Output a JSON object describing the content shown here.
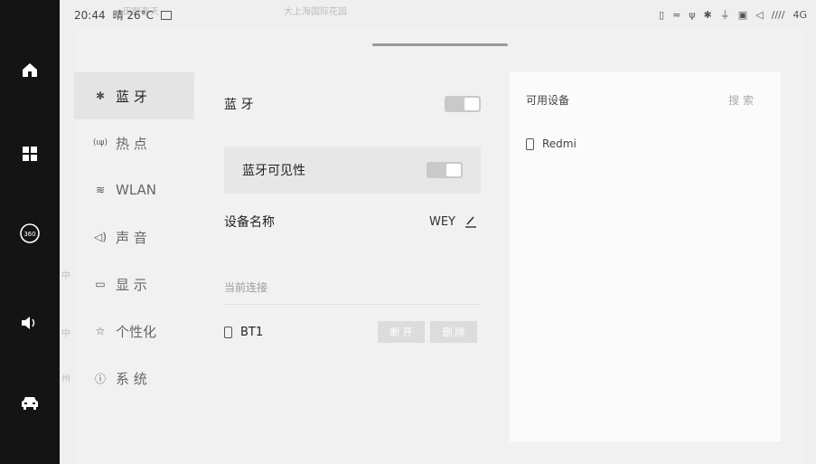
{
  "status": {
    "time": "20:44",
    "weather": "晴 26°C",
    "right_text": "4G"
  },
  "map_labels": [
    "大上海国际花园",
    "田野春天",
    "中",
    "中",
    "州"
  ],
  "dock": [
    {
      "name": "home",
      "icon": "home-icon"
    },
    {
      "name": "apps",
      "icon": "grid-icon"
    },
    {
      "name": "360",
      "icon": "camera-360-icon",
      "label": "360"
    },
    {
      "name": "volume",
      "icon": "speaker-icon"
    },
    {
      "name": "car",
      "icon": "car-icon"
    }
  ],
  "sidebar": {
    "items": [
      {
        "label": "蓝 牙",
        "icon": "bluetooth-icon",
        "glyph": "✱"
      },
      {
        "label": "热 点",
        "icon": "hotspot-icon",
        "glyph": "(ιψ)"
      },
      {
        "label": "WLAN",
        "icon": "wifi-icon",
        "glyph": "≋"
      },
      {
        "label": "声 音",
        "icon": "sound-icon",
        "glyph": "◁)"
      },
      {
        "label": "显 示",
        "icon": "display-icon",
        "glyph": "▭"
      },
      {
        "label": "个性化",
        "icon": "personalize-icon",
        "glyph": "☆"
      },
      {
        "label": "系 统",
        "icon": "system-icon",
        "glyph": "ⓘ"
      }
    ]
  },
  "bluetooth": {
    "title": "蓝 牙",
    "visibility_label": "蓝牙可见性",
    "device_name_label": "设备名称",
    "device_name_value": "WEY",
    "current_connection_label": "当前连接",
    "connected_device": "BT1",
    "disconnect_label": "断 开",
    "delete_label": "删 除"
  },
  "available": {
    "title": "可用设备",
    "search_label": "搜 索",
    "devices": [
      "Redmi"
    ]
  }
}
